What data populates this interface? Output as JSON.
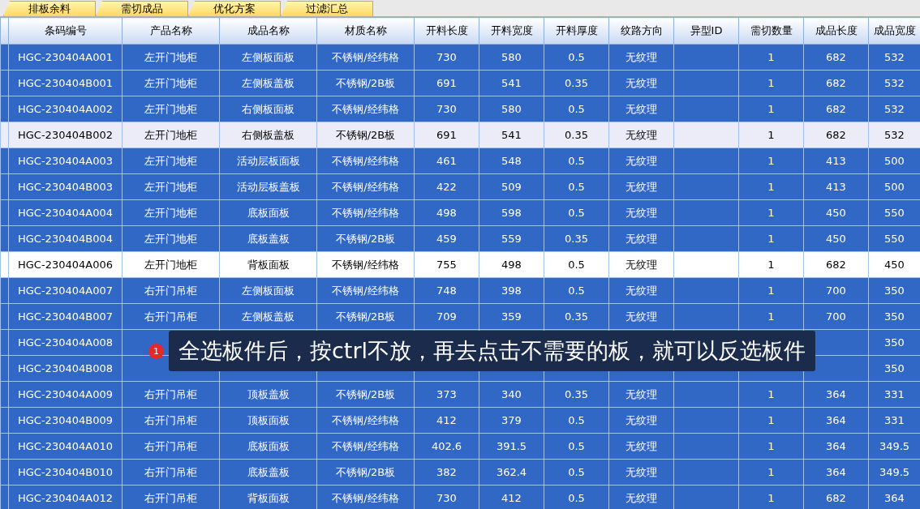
{
  "tabs": [
    {
      "label": "排板余料"
    },
    {
      "label": "需切成品"
    },
    {
      "label": "优化方案"
    },
    {
      "label": "过滤汇总"
    }
  ],
  "table": {
    "columns": [
      "",
      "条码编号",
      "产品名称",
      "成品名称",
      "材质名称",
      "开料长度",
      "开料宽度",
      "开料厚度",
      "纹路方向",
      "异型ID",
      "需切数量",
      "成品长度",
      "成品宽度"
    ],
    "rows": [
      {
        "selected": true,
        "cells": [
          "",
          "HGC-230404A001",
          "左开门地柜",
          "左侧板面板",
          "不锈钢/经纬格",
          "730",
          "580",
          "0.5",
          "无纹理",
          "",
          "1",
          "682",
          "532"
        ]
      },
      {
        "selected": true,
        "cells": [
          "",
          "HGC-230404B001",
          "左开门地柜",
          "左侧板盖板",
          "不锈钢/2B板",
          "691",
          "541",
          "0.35",
          "无纹理",
          "",
          "1",
          "682",
          "532"
        ]
      },
      {
        "selected": true,
        "cells": [
          "",
          "HGC-230404A002",
          "左开门地柜",
          "右侧板面板",
          "不锈钢/经纬格",
          "730",
          "580",
          "0.5",
          "无纹理",
          "",
          "1",
          "682",
          "532"
        ]
      },
      {
        "selected": false,
        "cells": [
          "",
          "HGC-230404B002",
          "左开门地柜",
          "右侧板盖板",
          "不锈钢/2B板",
          "691",
          "541",
          "0.35",
          "无纹理",
          "",
          "1",
          "682",
          "532"
        ]
      },
      {
        "selected": true,
        "cells": [
          "",
          "HGC-230404A003",
          "左开门地柜",
          "活动层板面板",
          "不锈钢/经纬格",
          "461",
          "548",
          "0.5",
          "无纹理",
          "",
          "1",
          "413",
          "500"
        ]
      },
      {
        "selected": true,
        "cells": [
          "",
          "HGC-230404B003",
          "左开门地柜",
          "活动层板盖板",
          "不锈钢/经纬格",
          "422",
          "509",
          "0.5",
          "无纹理",
          "",
          "1",
          "413",
          "500"
        ]
      },
      {
        "selected": true,
        "cells": [
          "",
          "HGC-230404A004",
          "左开门地柜",
          "底板面板",
          "不锈钢/经纬格",
          "498",
          "598",
          "0.5",
          "无纹理",
          "",
          "1",
          "450",
          "550"
        ]
      },
      {
        "selected": true,
        "cells": [
          "",
          "HGC-230404B004",
          "左开门地柜",
          "底板盖板",
          "不锈钢/2B板",
          "459",
          "559",
          "0.35",
          "无纹理",
          "",
          "1",
          "450",
          "550"
        ]
      },
      {
        "selected": false,
        "cells": [
          "",
          "HGC-230404A006",
          "左开门地柜",
          "背板面板",
          "不锈钢/经纬格",
          "755",
          "498",
          "0.5",
          "无纹理",
          "",
          "1",
          "682",
          "450"
        ]
      },
      {
        "selected": true,
        "cells": [
          "",
          "HGC-230404A007",
          "右开门吊柜",
          "左侧板面板",
          "不锈钢/经纬格",
          "748",
          "398",
          "0.5",
          "无纹理",
          "",
          "1",
          "700",
          "350"
        ]
      },
      {
        "selected": true,
        "cells": [
          "",
          "HGC-230404B007",
          "右开门吊柜",
          "左侧板盖板",
          "不锈钢/2B板",
          "709",
          "359",
          "0.35",
          "无纹理",
          "",
          "1",
          "700",
          "350"
        ]
      },
      {
        "selected": true,
        "cells": [
          "",
          "HGC-230404A008",
          null,
          null,
          null,
          null,
          null,
          null,
          null,
          "",
          null,
          null,
          "350"
        ]
      },
      {
        "selected": true,
        "cells": [
          "",
          "HGC-230404B008",
          null,
          null,
          null,
          null,
          null,
          null,
          null,
          "",
          null,
          null,
          "350"
        ]
      },
      {
        "selected": true,
        "cells": [
          "",
          "HGC-230404A009",
          "右开门吊柜",
          "顶板盖板",
          "不锈钢/2B板",
          "373",
          "340",
          "0.35",
          "无纹理",
          "",
          "1",
          "364",
          "331"
        ]
      },
      {
        "selected": true,
        "cells": [
          "",
          "HGC-230404B009",
          "右开门吊柜",
          "顶板面板",
          "不锈钢/经纬格",
          "412",
          "379",
          "0.5",
          "无纹理",
          "",
          "1",
          "364",
          "331"
        ]
      },
      {
        "selected": true,
        "cells": [
          "",
          "HGC-230404A010",
          "右开门吊柜",
          "底板面板",
          "不锈钢/经纬格",
          "402.6",
          "391.5",
          "0.5",
          "无纹理",
          "",
          "1",
          "364",
          "349.5"
        ]
      },
      {
        "selected": true,
        "cells": [
          "",
          "HGC-230404B010",
          "右开门吊柜",
          "底板盖板",
          "不锈钢/2B板",
          "382",
          "362.4",
          "0.5",
          "无纹理",
          "",
          "1",
          "364",
          "349.5"
        ]
      },
      {
        "selected": true,
        "cells": [
          "",
          "HGC-230404A012",
          "右开门吊柜",
          "背板面板",
          "不锈钢/经纬格",
          "730",
          "412",
          "0.5",
          "无纹理",
          "",
          "1",
          "682",
          "364"
        ]
      }
    ]
  },
  "tip": {
    "badge": "1",
    "text": "全选板件后，按ctrl不放，再去点击不需要的板，就可以反选板件"
  }
}
